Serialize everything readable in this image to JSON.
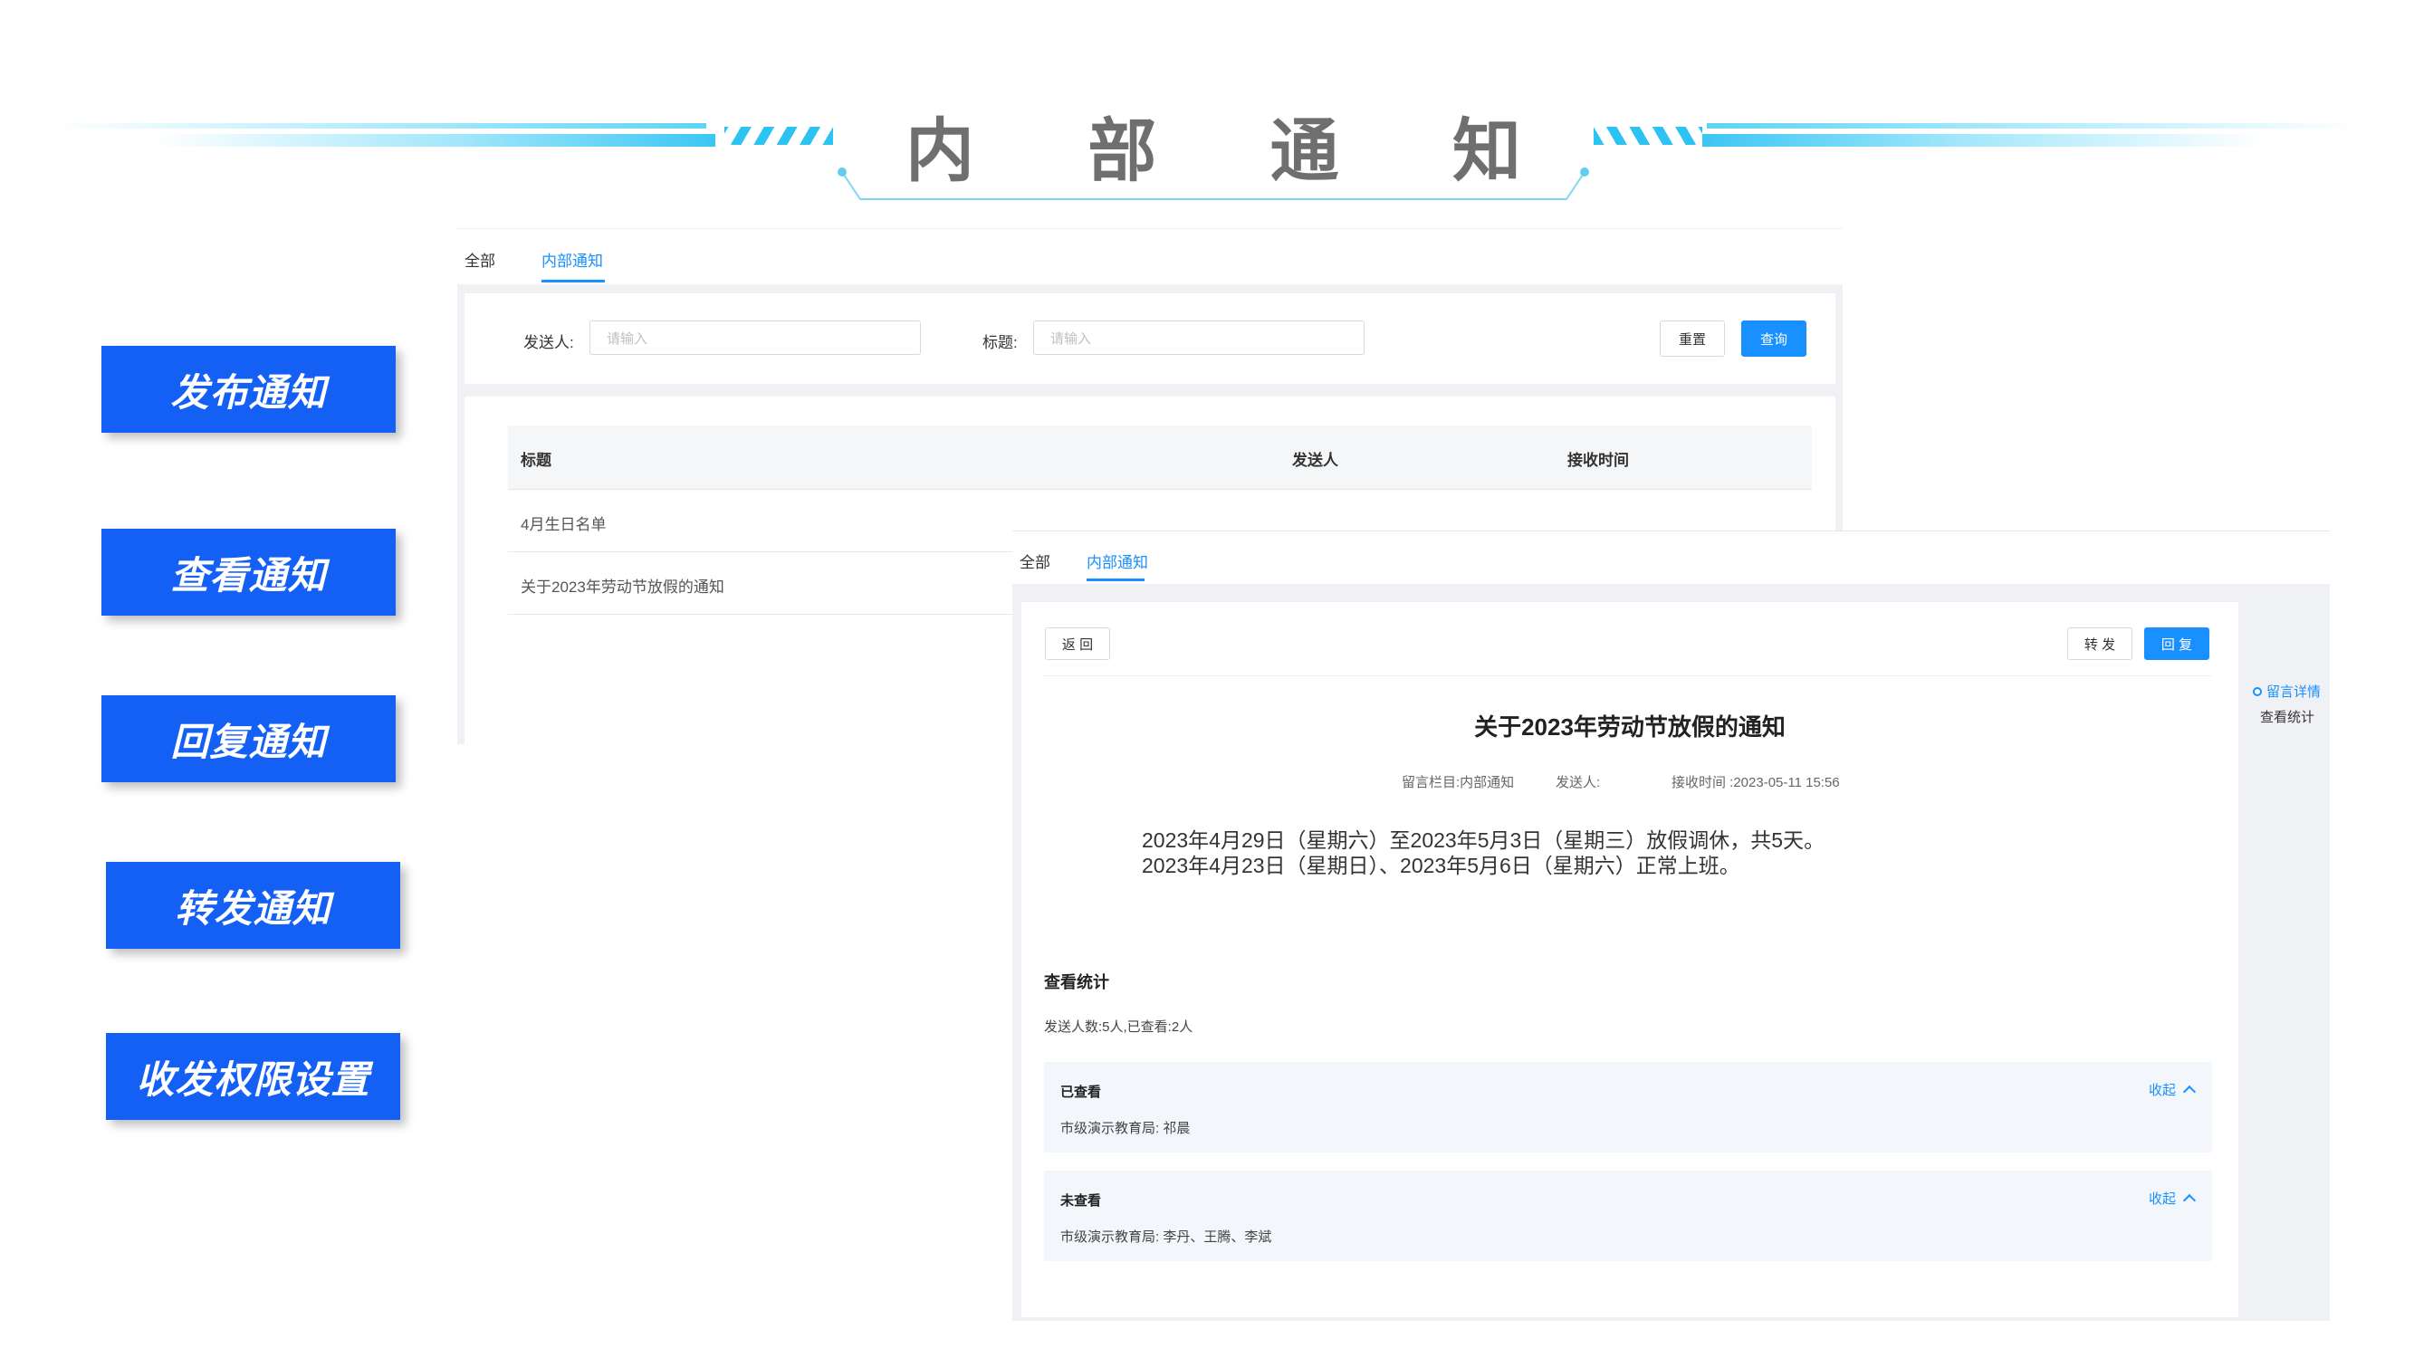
{
  "header": {
    "title_chars": [
      "内",
      "部",
      "通",
      "知"
    ],
    "accent_color": "#2cc3f3"
  },
  "features": {
    "publish": "发布通知",
    "view": "查看通知",
    "reply": "回复通知",
    "forward": "转发通知",
    "permissions": "收发权限设置"
  },
  "list_window": {
    "tabs": {
      "all": "全部",
      "internal": "内部通知"
    },
    "filters": {
      "sender_label": "发送人:",
      "sender_placeholder": "请输入",
      "title_label": "标题:",
      "title_placeholder": "请输入",
      "reset": "重置",
      "search": "查询"
    },
    "table": {
      "columns": {
        "title": "标题",
        "sender": "发送人",
        "received": "接收时间"
      },
      "rows": [
        {
          "title": "4月生日名单",
          "sender": "",
          "received": ""
        },
        {
          "title": "关于2023年劳动节放假的通知",
          "sender": "",
          "received": ""
        }
      ]
    }
  },
  "detail_window": {
    "tabs": {
      "all": "全部",
      "internal": "内部通知"
    },
    "actions": {
      "back": "返 回",
      "forward": "转 发",
      "reply": "回 复"
    },
    "doc": {
      "title": "关于2023年劳动节放假的通知",
      "column": "留言栏目:内部通知",
      "sender": "发送人:",
      "received": "接收时间 :2023-05-11 15:56",
      "body": [
        "2023年4月29日（星期六）至2023年5月3日（星期三）放假调休，共5天。",
        "2023年4月23日（星期日）、2023年5月6日（星期六）正常上班。"
      ]
    },
    "stats": {
      "heading": "查看统计",
      "summary": "发送人数:5人,已查看:2人",
      "viewed": {
        "title": "已查看",
        "content": "市级演示教育局: 祁晨",
        "toggle": "收起"
      },
      "unviewed": {
        "title": "未查看",
        "content": "市级演示教育局: 李丹、王腾、李斌",
        "toggle": "收起"
      }
    },
    "anchors": {
      "comments": "留言详情",
      "stats": "查看统计"
    }
  }
}
